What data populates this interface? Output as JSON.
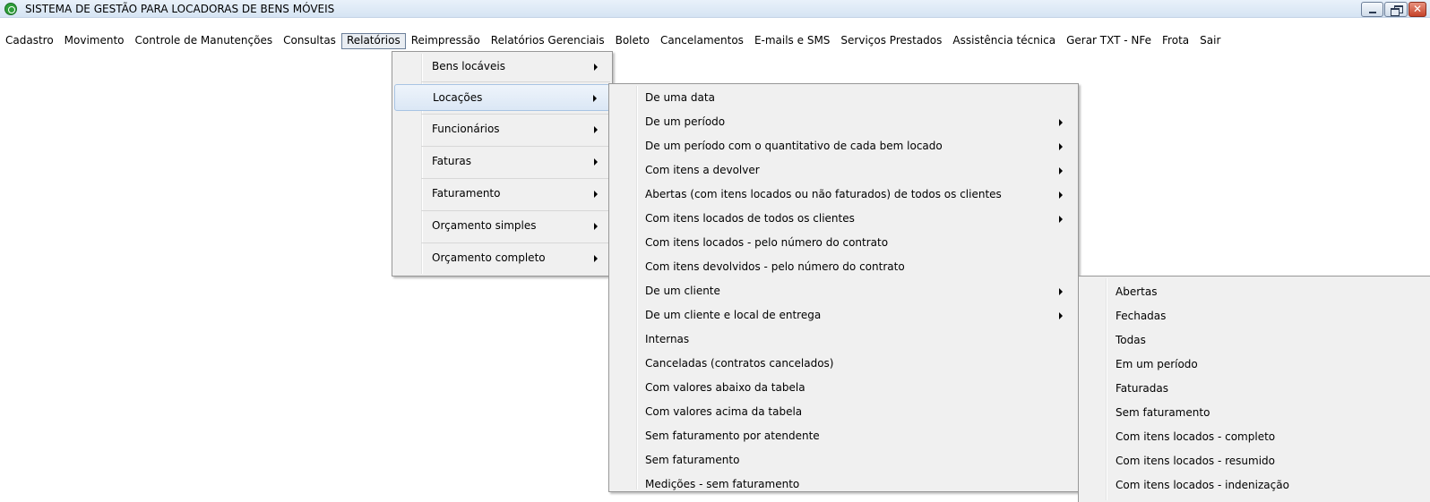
{
  "window": {
    "title": "SISTEMA DE GESTÃO PARA LOCADORAS DE BENS MÓVEIS"
  },
  "menubar": {
    "items": [
      {
        "label": "Cadastro"
      },
      {
        "label": "Movimento"
      },
      {
        "label": "Controle de Manutenções"
      },
      {
        "label": "Consultas"
      },
      {
        "label": "Relatórios",
        "active": true
      },
      {
        "label": "Reimpressão"
      },
      {
        "label": "Relatórios Gerenciais"
      },
      {
        "label": "Boleto"
      },
      {
        "label": "Cancelamentos"
      },
      {
        "label": "E-mails e SMS"
      },
      {
        "label": "Serviços Prestados"
      },
      {
        "label": "Assistência técnica"
      },
      {
        "label": "Gerar TXT - NFe"
      },
      {
        "label": "Frota"
      },
      {
        "label": "Sair"
      }
    ]
  },
  "relatorios_menu": {
    "items": [
      {
        "label": "Bens locáveis",
        "submenu": true
      },
      {
        "label": "Locações",
        "submenu": true,
        "highlighted": true
      },
      {
        "label": "Funcionários",
        "submenu": true
      },
      {
        "label": "Faturas",
        "submenu": true
      },
      {
        "label": "Faturamento",
        "submenu": true
      },
      {
        "label": "Orçamento simples",
        "submenu": true
      },
      {
        "label": "Orçamento completo",
        "submenu": true
      }
    ]
  },
  "locacoes_menu": {
    "items": [
      {
        "label": "De uma data",
        "submenu": false
      },
      {
        "label": "De um período",
        "submenu": true
      },
      {
        "label": "De um período com o quantitativo de cada bem locado",
        "submenu": true
      },
      {
        "label": "Com itens a devolver",
        "submenu": true
      },
      {
        "label": "Abertas (com itens locados ou não faturados) de todos os clientes",
        "submenu": true
      },
      {
        "label": "Com itens locados de todos os clientes",
        "submenu": true
      },
      {
        "label": "Com itens locados - pelo número do contrato",
        "submenu": false
      },
      {
        "label": "Com itens devolvidos - pelo número do contrato",
        "submenu": false
      },
      {
        "label": "De um cliente",
        "submenu": true
      },
      {
        "label": "De um cliente e local de entrega",
        "submenu": true
      },
      {
        "label": "Internas",
        "submenu": false
      },
      {
        "label": "Canceladas (contratos cancelados)",
        "submenu": false
      },
      {
        "label": "Com valores abaixo da tabela",
        "submenu": false
      },
      {
        "label": "Com valores acima da tabela",
        "submenu": false
      },
      {
        "label": "Sem faturamento por atendente",
        "submenu": false
      },
      {
        "label": "Sem faturamento",
        "submenu": false
      },
      {
        "label": "Medições - sem faturamento",
        "submenu": false
      }
    ]
  },
  "cliente_menu": {
    "items": [
      {
        "label": "Abertas"
      },
      {
        "label": "Fechadas"
      },
      {
        "label": "Todas"
      },
      {
        "label": "Em um período"
      },
      {
        "label": "Faturadas"
      },
      {
        "label": "Sem faturamento"
      },
      {
        "label": "Com itens locados - completo"
      },
      {
        "label": "Com itens locados - resumido"
      },
      {
        "label": "Com itens locados - indenização"
      }
    ]
  }
}
